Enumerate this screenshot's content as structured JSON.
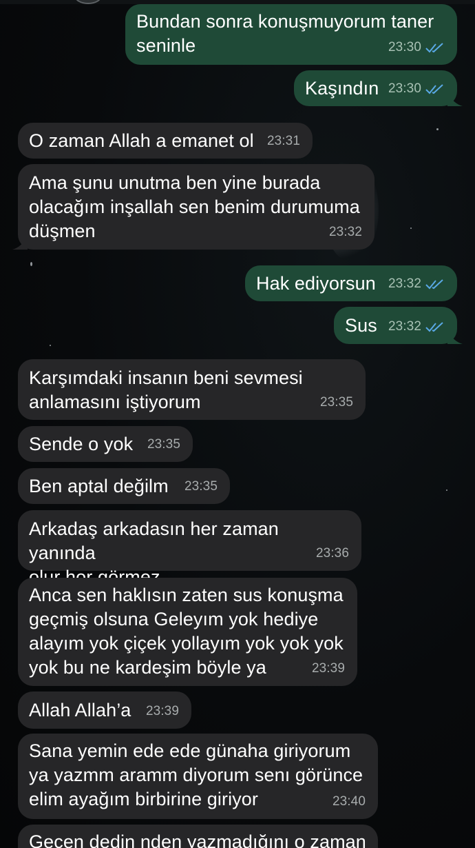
{
  "messages": [
    {
      "dir": "out",
      "text": "Bundan sonra konuşmuyorum taner\nseninle",
      "time": "23:30",
      "status": "read"
    },
    {
      "dir": "out",
      "text": "Kaşındın",
      "time": "23:30",
      "status": "read"
    },
    {
      "dir": "in",
      "text": "O zaman Allah a emanet ol",
      "time": "23:31"
    },
    {
      "dir": "in",
      "text": "Ama şunu unutma ben yine burada\nolacağım inşallah sen benim durumuma\ndüşmen",
      "time": "23:32"
    },
    {
      "dir": "out",
      "text": "Hak ediyorsun",
      "time": "23:32",
      "status": "read"
    },
    {
      "dir": "out",
      "text": "Sus",
      "time": "23:32",
      "status": "read"
    },
    {
      "dir": "in",
      "text": "Karşımdaki insanın beni sevmesi\nanlamasını iştiyorum",
      "time": "23:35"
    },
    {
      "dir": "in",
      "text": "Sende o yok",
      "time": "23:35"
    },
    {
      "dir": "in",
      "text": "Ben aptal değilm",
      "time": "23:35"
    },
    {
      "dir": "in",
      "text": "Arkadaş arkadasın her zaman yanında\nolur hor görmez",
      "time": "23:36"
    },
    {
      "dir": "in",
      "text": "Anca sen haklısın zaten sus konuşma\ngeçmiş olsuna Geleyım yok hediye\nalayım yok çiçek yollayım yok yok yok\nyok bu ne kardeşim böyle ya",
      "time": "23:39"
    },
    {
      "dir": "in",
      "text": "Allah Allah’a",
      "time": "23:39"
    },
    {
      "dir": "in",
      "text": "Sana yemin ede ede günaha giriyorum\nya yazmm aramm diyorum senı görünce\nelim ayağım birbirine giriyor",
      "time": "23:40"
    },
    {
      "dir": "in",
      "text": "Geçen dedin nden yazmadığını o zaman",
      "time": ""
    }
  ],
  "colors": {
    "incoming_bubble": "#262628",
    "outgoing_bubble": "#1f4a37",
    "read_check": "#5aa9e6",
    "background": "#07090b"
  },
  "icons": {
    "read_receipt": "double-check-icon",
    "avatar": "avatar"
  }
}
